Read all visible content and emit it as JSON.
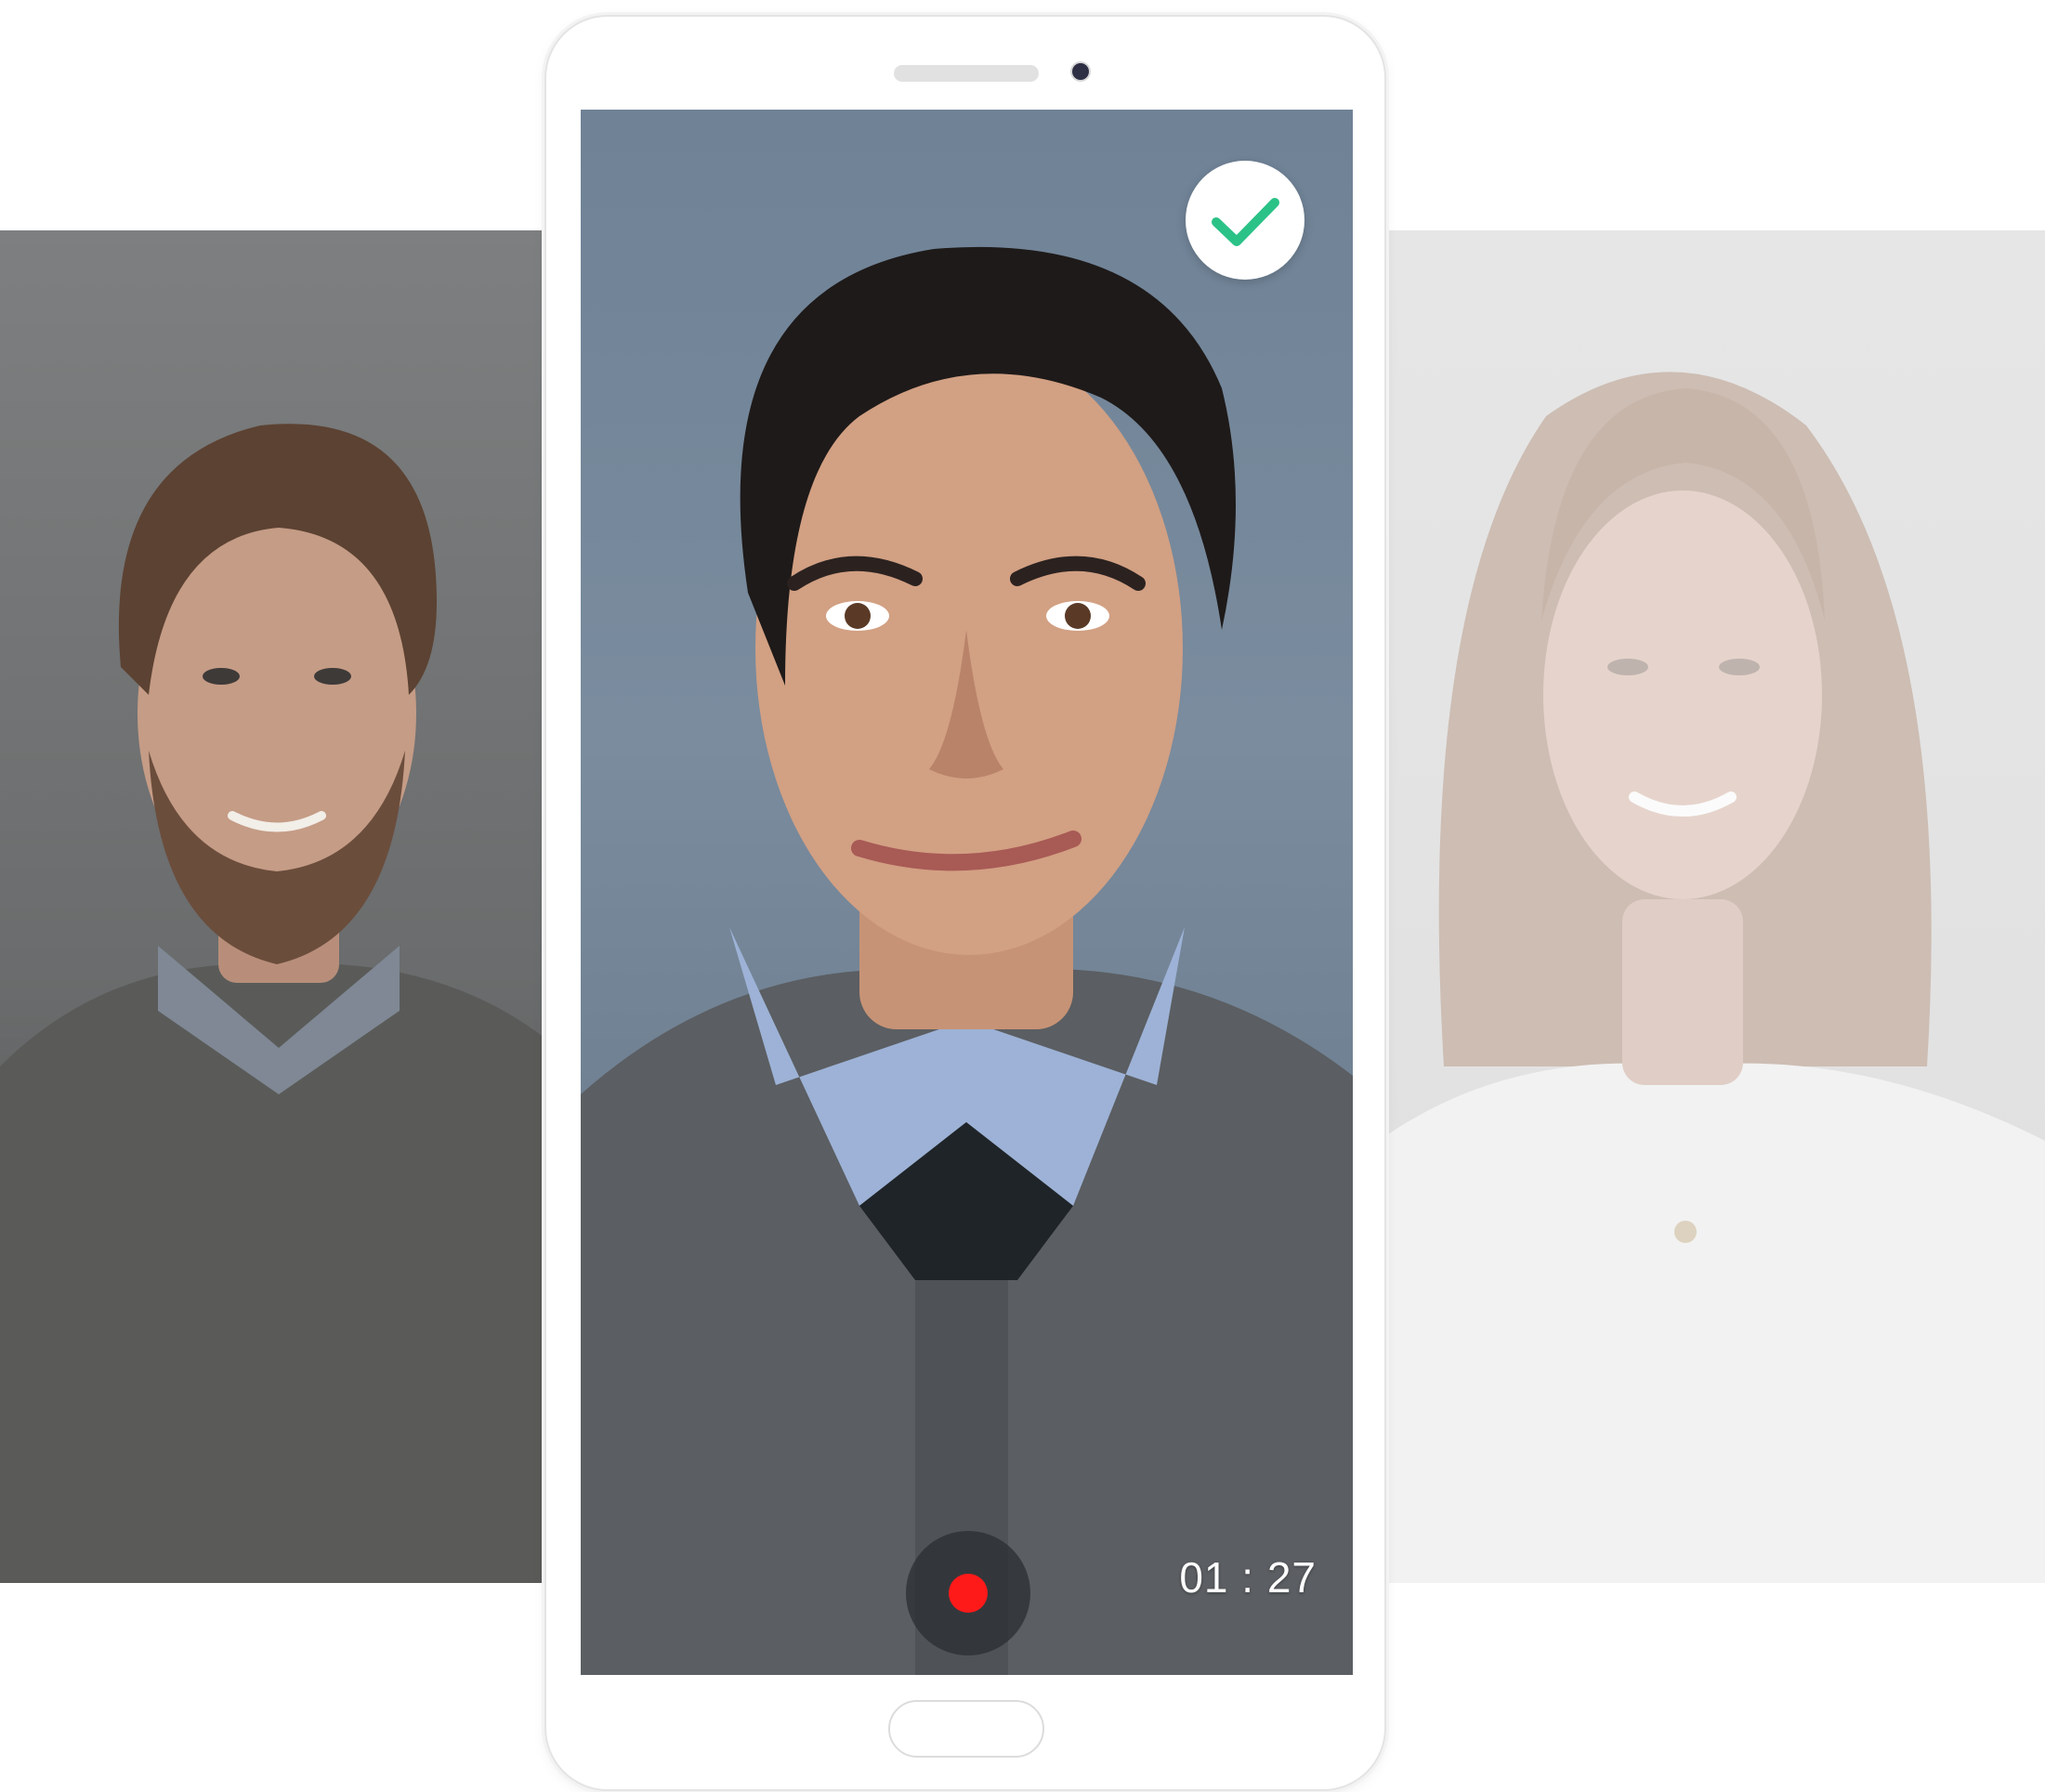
{
  "recording": {
    "timer_text": "01 : 27",
    "status": "recording"
  },
  "icons": {
    "verified": "check-icon",
    "record": "record-dot-icon"
  },
  "colors": {
    "check_green": "#2bc287",
    "record_red": "#ff1a1a",
    "phone_frame": "#ffffff"
  },
  "candidates": [
    {
      "position": "left",
      "state": "dimmed"
    },
    {
      "position": "center",
      "state": "active"
    },
    {
      "position": "right",
      "state": "faded"
    }
  ]
}
